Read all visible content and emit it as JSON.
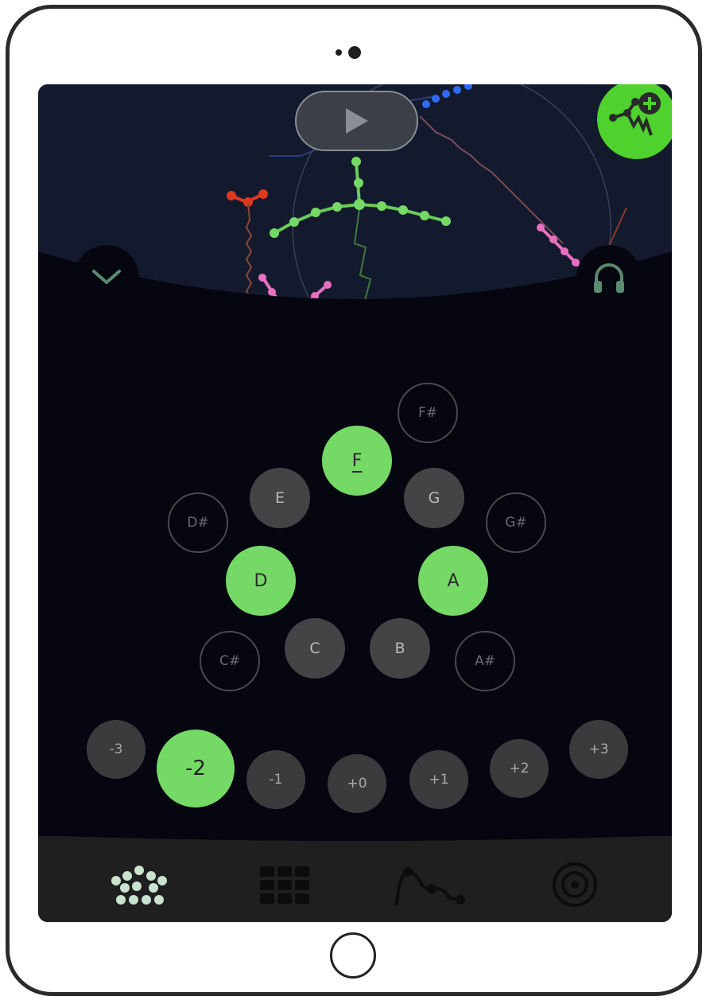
{
  "transport": {
    "play_icon": "play-icon"
  },
  "top_right_button": {
    "icon": "add-molecule-icon",
    "color": "#4fd12e"
  },
  "left_button": {
    "icon": "chevron-down-icon"
  },
  "right_button": {
    "icon": "headphones-icon"
  },
  "notes": {
    "F_sharp": "F#",
    "F": "F",
    "E": "E",
    "G": "G",
    "D_sharp": "D#",
    "G_sharp": "G#",
    "D": "D",
    "A": "A",
    "C_sharp": "C#",
    "C": "C",
    "B": "B",
    "A_sharp": "A#"
  },
  "octave_shift": [
    "-3",
    "-2",
    "-1",
    "+0",
    "+1",
    "+2",
    "+3"
  ],
  "selected_octave": "-2",
  "tabs": [
    {
      "icon": "note-cluster-icon",
      "active": true
    },
    {
      "icon": "grid-icon",
      "active": false
    },
    {
      "icon": "curve-icon",
      "active": false
    },
    {
      "icon": "record-target-icon",
      "active": false
    }
  ],
  "colors": {
    "accent_green": "#75d966",
    "background": "#05060f",
    "key_dark": "#444446",
    "tabbar": "#1f1f1f"
  }
}
